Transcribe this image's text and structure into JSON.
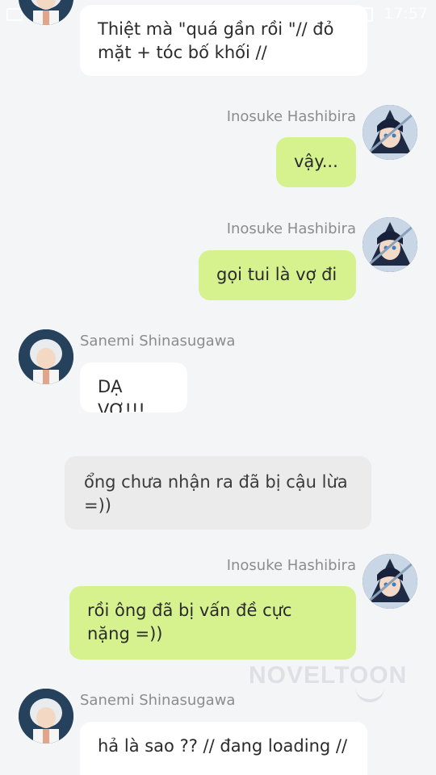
{
  "status_bar": {
    "time": "17:57"
  },
  "watermark": "NOVELTOON",
  "messages": [
    {
      "sender": "",
      "text": "Thiệt mà \"quá gần rồi \"// đỏ mặt + tóc bố khối //"
    },
    {
      "sender": "Inosuke Hashibira",
      "text": "vậy..."
    },
    {
      "sender": "Inosuke Hashibira",
      "text": "gọi tui là vợ đi"
    },
    {
      "sender": "Sanemi Shinasugawa",
      "text": "DẠ VỢ!!!"
    },
    {
      "sender": "",
      "text": "ổng chưa nhận ra đã bị cậu lừa =))"
    },
    {
      "sender": "Inosuke Hashibira",
      "text": "rồi ông đã bị vấn đề cực nặng =))"
    },
    {
      "sender": "Sanemi Shinasugawa",
      "text": "hả là sao ?? // đang loading //"
    }
  ],
  "avatars": {
    "inosuke": "inosuke-avatar",
    "sanemi": "sanemi-avatar"
  }
}
